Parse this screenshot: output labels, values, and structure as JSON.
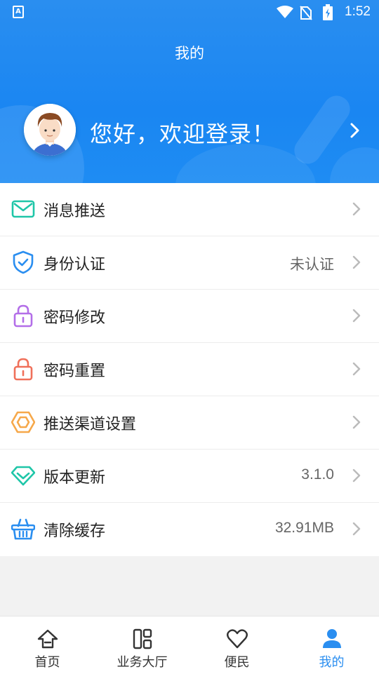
{
  "status_bar": {
    "time": "1:52",
    "app_indicator": "A"
  },
  "header": {
    "title": "我的",
    "welcome_text": "您好，欢迎登录！"
  },
  "menu": {
    "items": [
      {
        "label": "消息推送",
        "value": "",
        "icon": "mail-icon",
        "color": "#1fc6a8"
      },
      {
        "label": "身份认证",
        "value": "未认证",
        "icon": "shield-check-icon",
        "color": "#2a8ef0"
      },
      {
        "label": "密码修改",
        "value": "",
        "icon": "lock-icon",
        "color": "#b36ee8"
      },
      {
        "label": "密码重置",
        "value": "",
        "icon": "lock-icon",
        "color": "#f0705a"
      },
      {
        "label": "推送渠道设置",
        "value": "",
        "icon": "hexagon-nut-icon",
        "color": "#f6a84a"
      },
      {
        "label": "版本更新",
        "value": "3.1.0",
        "icon": "diamond-icon",
        "color": "#1fc6a8"
      },
      {
        "label": "清除缓存",
        "value": "32.91MB",
        "icon": "basket-icon",
        "color": "#2a8ef0"
      }
    ]
  },
  "tabbar": {
    "tabs": [
      {
        "label": "首页",
        "icon": "home-icon",
        "active": false
      },
      {
        "label": "业务大厅",
        "icon": "grid-icon",
        "active": false
      },
      {
        "label": "便民",
        "icon": "heart-icon",
        "active": false
      },
      {
        "label": "我的",
        "icon": "user-icon",
        "active": true
      }
    ],
    "active_color": "#2a8ef0"
  }
}
